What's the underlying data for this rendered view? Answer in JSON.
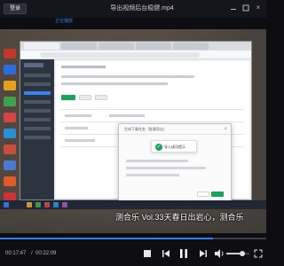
{
  "window": {
    "title": "导出视频后台稳健.mp4",
    "login_label": "登录",
    "sub_link": "正在播放",
    "close_glyph": "×"
  },
  "recording": {
    "dialog_title": "生成下载任务（批量导出）",
    "dialog_close": "×",
    "toast_text": "导入成功提示",
    "subtitle": "测合乐 Vol.33天春日出岩心，测合乐"
  },
  "controls": {
    "current_time": "00:17:47",
    "separator": "/",
    "total_time": "00:22:09",
    "progress": 0.8
  },
  "volume": {
    "level": 0.7
  },
  "icons": {
    "stop": "stop-icon",
    "prev": "previous-icon",
    "pause": "pause-icon",
    "next": "next-icon",
    "volume": "volume-icon",
    "fullscreen": "fullscreen-icon",
    "minimize": "minimize-icon",
    "maximize": "maximize-icon",
    "close": "close-icon"
  },
  "colors": {
    "accent": "#2f7cf6",
    "success": "#19a35b",
    "background": "#0d0d12"
  }
}
